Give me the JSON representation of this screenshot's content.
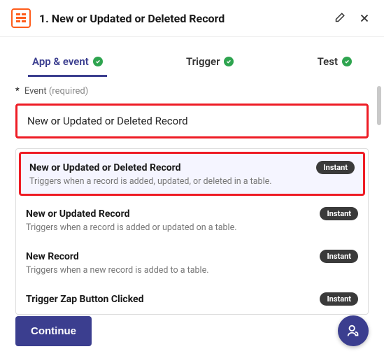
{
  "header": {
    "title": "1. New or Updated or Deleted Record"
  },
  "tabs": [
    {
      "label": "App & event",
      "active": true
    },
    {
      "label": "Trigger",
      "active": false
    },
    {
      "label": "Test",
      "active": false
    }
  ],
  "field": {
    "label": "Event",
    "required_text": "(required)",
    "selected": "New or Updated or Deleted Record"
  },
  "options": [
    {
      "title": "New or Updated or Deleted Record",
      "desc": "Triggers when a record is added, updated, or deleted in a table.",
      "badge": "Instant",
      "highlight": true
    },
    {
      "title": "New or Updated Record",
      "desc": "Triggers when a record is added or updated on a table.",
      "badge": "Instant",
      "highlight": false
    },
    {
      "title": "New Record",
      "desc": "Triggers when a new record is added to a table.",
      "badge": "Instant",
      "highlight": false
    },
    {
      "title": "Trigger Zap Button Clicked",
      "desc": "",
      "badge": "Instant",
      "highlight": false
    }
  ],
  "footer": {
    "continue": "Continue"
  }
}
